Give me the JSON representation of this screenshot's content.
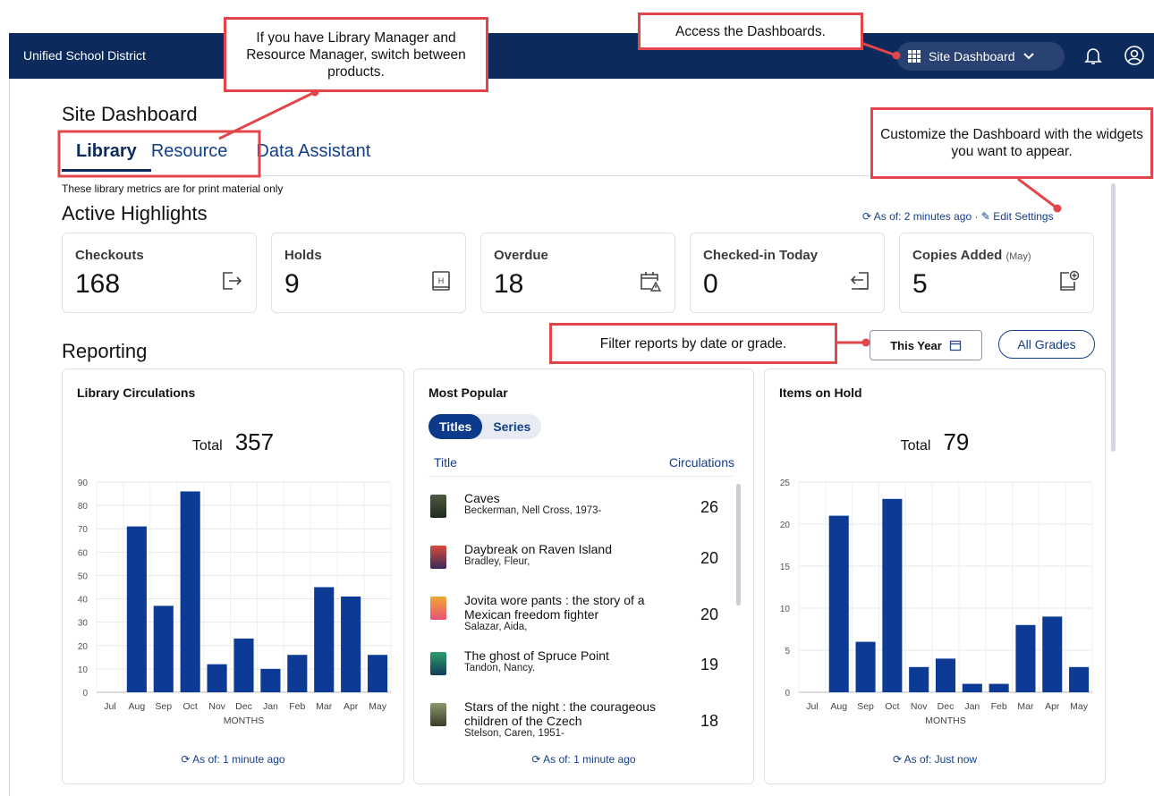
{
  "topbar": {
    "district": "Unified School District",
    "site_dashboard": "Site Dashboard"
  },
  "page": {
    "title": "Site Dashboard",
    "tabs": [
      "Library",
      "Resource",
      "Data Assistant"
    ],
    "note": "These library metrics are for print material only",
    "active_highlights": "Active Highlights",
    "asof_top": "As of: 2 minutes ago",
    "edit_settings": "Edit Settings"
  },
  "highlights": [
    {
      "label": "Checkouts",
      "value": "168"
    },
    {
      "label": "Holds",
      "value": "9"
    },
    {
      "label": "Overdue",
      "value": "18"
    },
    {
      "label": "Checked-in Today",
      "value": "0"
    },
    {
      "label": "Copies Added",
      "suffix": "(May)",
      "value": "5"
    }
  ],
  "reporting": {
    "title": "Reporting",
    "date_filter": "This Year",
    "grade_filter": "All Grades"
  },
  "circulations": {
    "title": "Library Circulations",
    "total_label": "Total",
    "total": "357",
    "asof": "As of: 1 minute ago"
  },
  "popular": {
    "title": "Most Popular",
    "pills": [
      "Titles",
      "Series"
    ],
    "col_title": "Title",
    "col_circ": "Circulations",
    "items": [
      {
        "title": "Caves",
        "author": "Beckerman, Nell Cross, 1973-",
        "count": "26"
      },
      {
        "title": "Daybreak on Raven Island",
        "author": "Bradley, Fleur,",
        "count": "20"
      },
      {
        "title": "Jovita wore pants : the story of a Mexican freedom fighter",
        "author": "Salazar, Aida,",
        "count": "20"
      },
      {
        "title": "The ghost of Spruce Point",
        "author": "Tandon, Nancy.",
        "count": "19"
      },
      {
        "title": "Stars of the night : the courageous children of the Czech",
        "author": "Stelson, Caren, 1951-",
        "count": "18"
      }
    ],
    "asof": "As of: 1 minute ago"
  },
  "holds": {
    "title": "Items on Hold",
    "total_label": "Total",
    "total": "79",
    "asof": "As of: Just now"
  },
  "callouts": {
    "products": "If you have Library Manager and Resource Manager, switch between products.",
    "dashboards": "Access the Dashboards.",
    "customize": "Customize the Dashboard with the widgets you want to appear.",
    "filter": "Filter reports by date or grade."
  },
  "chart_data": [
    {
      "type": "bar",
      "title": "Library Circulations",
      "categories": [
        "Jul",
        "Aug",
        "Sep",
        "Oct",
        "Nov",
        "Dec",
        "Jan",
        "Feb",
        "Mar",
        "Apr",
        "May"
      ],
      "values": [
        0,
        71,
        37,
        86,
        12,
        23,
        10,
        16,
        45,
        41,
        16
      ],
      "xlabel": "MONTHS",
      "ylabel": "",
      "ylim": [
        0,
        90
      ],
      "yticks": [
        0,
        10,
        20,
        30,
        40,
        50,
        60,
        70,
        80,
        90
      ],
      "color": "#0c3a94"
    },
    {
      "type": "bar",
      "title": "Items on Hold",
      "categories": [
        "Jul",
        "Aug",
        "Sep",
        "Oct",
        "Nov",
        "Dec",
        "Jan",
        "Feb",
        "Mar",
        "Apr",
        "May"
      ],
      "values": [
        0,
        21,
        6,
        23,
        3,
        4,
        1,
        1,
        8,
        9,
        3
      ],
      "xlabel": "MONTHS",
      "ylabel": "",
      "ylim": [
        0,
        25
      ],
      "yticks": [
        0,
        5,
        10,
        15,
        20,
        25
      ],
      "color": "#0c3a94"
    }
  ]
}
